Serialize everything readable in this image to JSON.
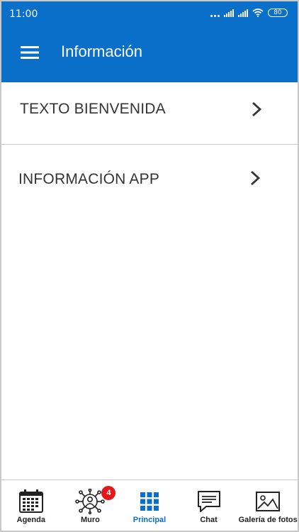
{
  "status_bar": {
    "time": "11:00",
    "battery": "80"
  },
  "app_bar": {
    "title": "Información",
    "menu_icon": "hamburger-menu-icon"
  },
  "list": {
    "items": [
      {
        "label": "TEXTO BIENVENIDA",
        "icon": "chevron-right-icon"
      },
      {
        "label": "INFORMACIÓN APP",
        "icon": "chevron-right-icon"
      }
    ]
  },
  "bottom_nav": {
    "items": [
      {
        "label": "Agenda",
        "icon": "calendar-icon",
        "active": false
      },
      {
        "label": "Muro",
        "icon": "network-users-icon",
        "badge": "4",
        "active": false
      },
      {
        "label": "Principal",
        "icon": "grid-icon",
        "active": true
      },
      {
        "label": "Chat",
        "icon": "chat-bubble-icon",
        "active": false
      },
      {
        "label": "Galería de fotos",
        "icon": "image-icon",
        "active": false
      }
    ]
  },
  "colors": {
    "primary": "#0a6fc8",
    "badge": "#e2161b",
    "text": "#333333",
    "divider": "#c9c9c9"
  }
}
